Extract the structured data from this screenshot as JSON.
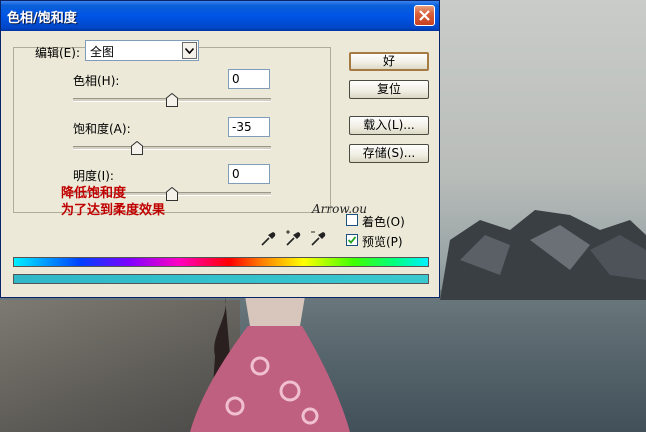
{
  "dialog": {
    "title": "色相/饱和度",
    "edit": {
      "label": "编辑(E):",
      "value": "全图"
    },
    "hue": {
      "label": "色相(H):",
      "value": "0"
    },
    "saturation": {
      "label": "饱和度(A):",
      "value": "-35"
    },
    "lightness": {
      "label": "明度(I):",
      "value": "0"
    },
    "buttons": {
      "ok": "好",
      "reset": "复位",
      "load": "载入(L)...",
      "save": "存储(S)..."
    },
    "colorize": {
      "label": "着色(O)",
      "checked": false
    },
    "preview": {
      "label": "预览(P)",
      "checked": true
    },
    "eyedroppers": [
      "eyedropper-icon",
      "eyedropper-plus-icon",
      "eyedropper-minus-icon"
    ]
  },
  "annotation": {
    "line1": "降低饱和度",
    "line2": "为了达到柔度效果",
    "color": "#c00000"
  },
  "watermark": "Arrow.ou",
  "colors": {
    "titlebar": "#0055e5",
    "dialog_bg": "#ece9d8",
    "close": "#d8603a"
  }
}
